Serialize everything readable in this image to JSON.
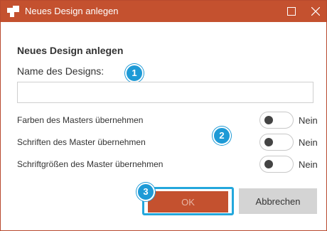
{
  "window": {
    "title": "Neues Design anlegen",
    "colors": {
      "titlebar": "#c4512f",
      "accent_badge": "#1e9ad6",
      "highlight_frame": "#23a7dc"
    },
    "controls": {
      "maximize_icon": "maximize-icon",
      "close_icon": "close-icon"
    }
  },
  "dialog": {
    "heading": "Neues Design anlegen",
    "name_label": "Name des Designs:",
    "name_value": "",
    "options": [
      {
        "label": "Farben des Masters übernehmen",
        "state": "Nein"
      },
      {
        "label": "Schriften des Master übernehmen",
        "state": "Nein"
      },
      {
        "label": "Schriftgrößen des Master übernehmen",
        "state": "Nein"
      }
    ],
    "ok_label": "OK",
    "cancel_label": "Abbrechen"
  },
  "callouts": {
    "one": "1",
    "two": "2",
    "three": "3"
  }
}
